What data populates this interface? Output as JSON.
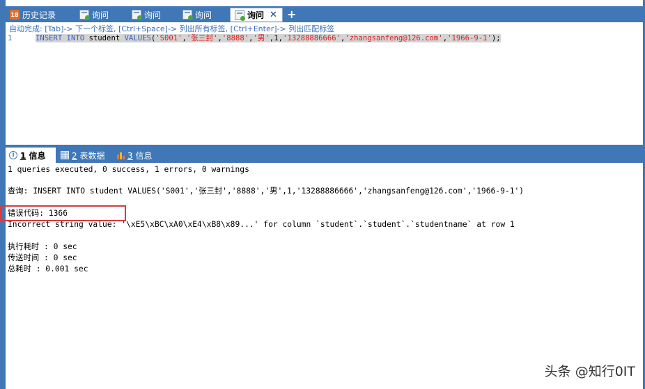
{
  "tabs": [
    {
      "label": "历史记录",
      "icon": "history-icon",
      "active": false
    },
    {
      "label": "询问",
      "icon": "query-icon",
      "active": false
    },
    {
      "label": "询问",
      "icon": "query-icon",
      "active": false
    },
    {
      "label": "询问",
      "icon": "query-icon",
      "active": false
    },
    {
      "label": "询问",
      "icon": "query-icon",
      "active": true
    }
  ],
  "tab_close": "✕",
  "tab_add": "+",
  "history_icon_text": "18",
  "editor": {
    "hint": "自动完成: [Tab]-> 下一个标签, [Ctrl+Space]-> 列出所有标签, [Ctrl+Enter]-> 列出匹配标签",
    "line_number": "1",
    "sql": {
      "kw1": "INSERT INTO",
      "table": " student ",
      "kw2": "VALUES",
      "open": "(",
      "v1": "'S001'",
      "v2": "'张三封'",
      "v3": "'8888'",
      "v4": "'男'",
      "v5": "1",
      "v6": "'13288886666'",
      "v7": "'zhangsanfeng@126.com'",
      "v8": "'1966-9-1'",
      "comma": ",",
      "close": ");"
    }
  },
  "result_tabs": [
    {
      "num": "1",
      "label": " 信息",
      "icon": "info-icon",
      "active": true
    },
    {
      "num": "2",
      "label": " 表数据",
      "icon": "grid-icon",
      "active": false
    },
    {
      "num": "3",
      "label": " 信息",
      "icon": "bars-icon",
      "active": false
    }
  ],
  "info_icon_glyph": "i",
  "output": {
    "summary": "1 queries executed, 0 success, 1 errors, 0 warnings",
    "query": "查询: INSERT INTO student VALUES('S001','张三封','8888','男',1,'13288886666','zhangsanfeng@126.com','1966-9-1')",
    "error_code": "错误代码: 1366",
    "error_message": "Incorrect string value: '\\xE5\\xBC\\xA0\\xE4\\xB8\\x89...' for column `student`.`student`.`studentname` at row 1",
    "exec_time": "执行耗时   : 0 sec",
    "transfer_time": "传送时间   : 0 sec",
    "total_time": "总耗时      : 0.001 sec"
  },
  "watermark": "头条 @知行0IT",
  "colors": {
    "frame": "#3f77b7",
    "error_box": "#d93a3a",
    "keyword": "#3b5fc7",
    "string": "#e02020"
  }
}
